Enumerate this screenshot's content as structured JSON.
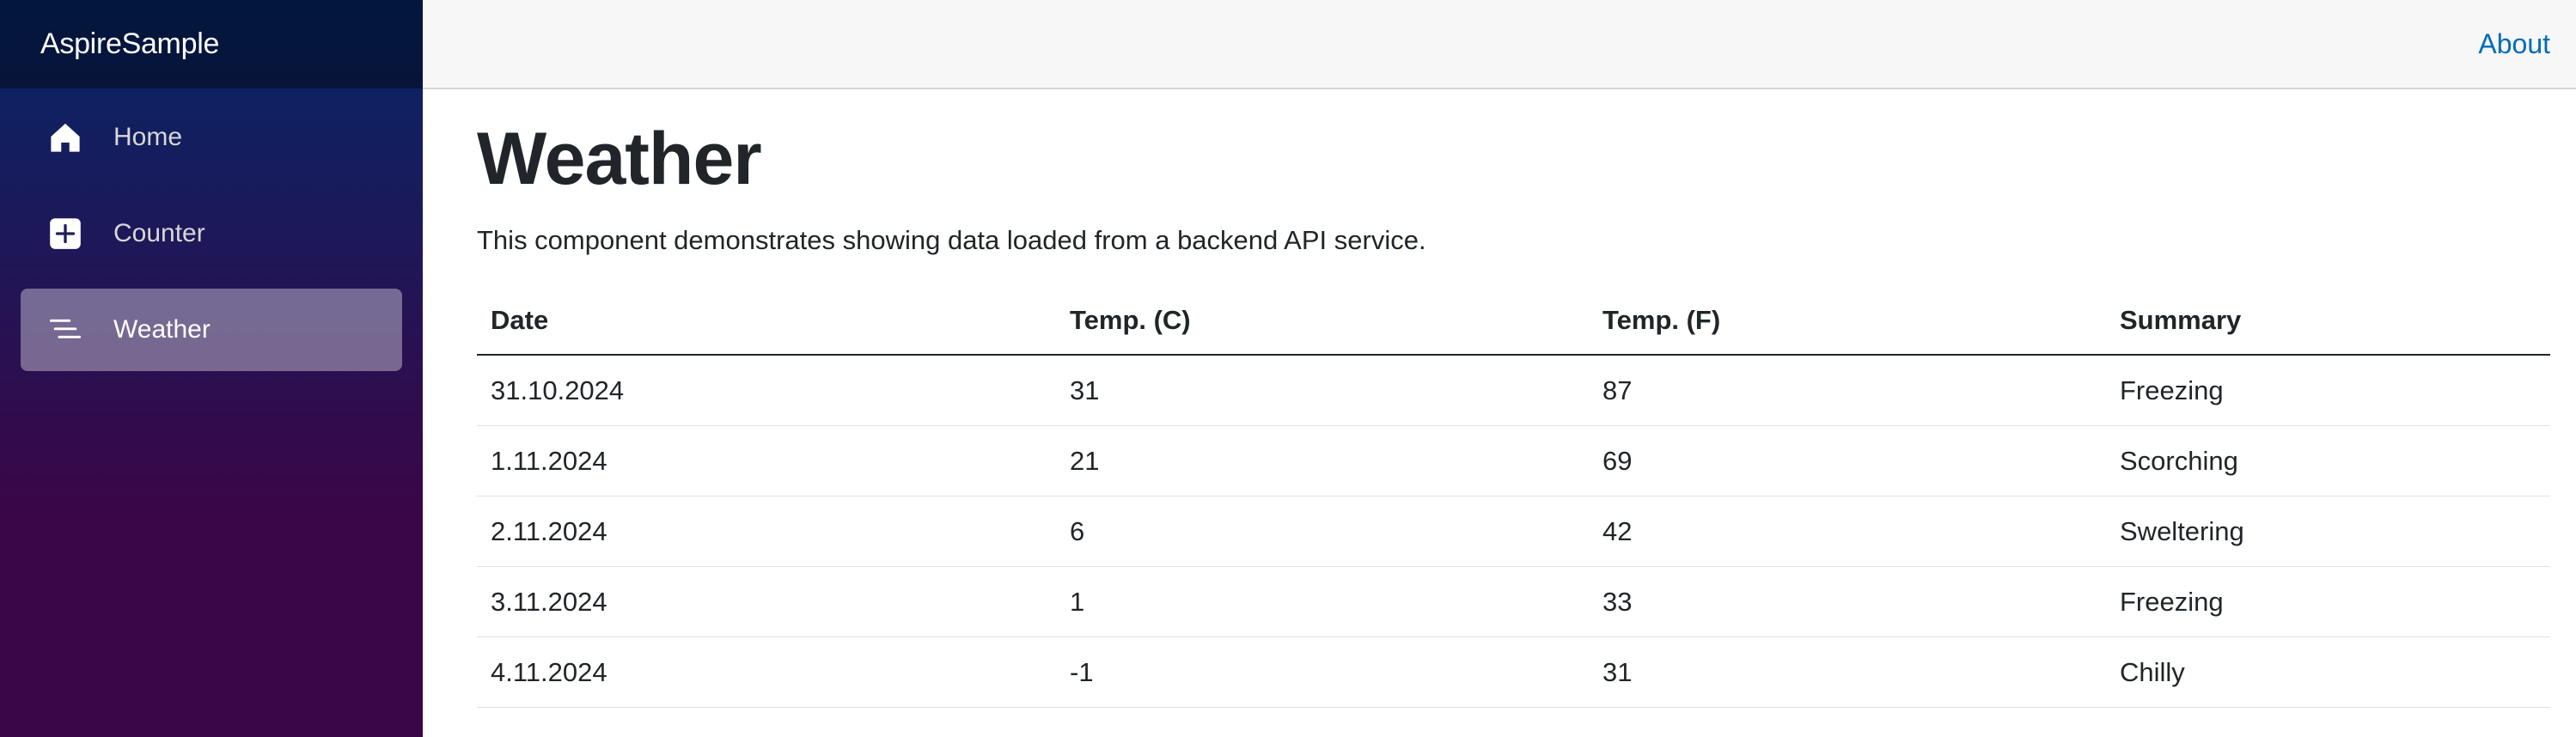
{
  "app": {
    "brand": "AspireSample"
  },
  "sidebar": {
    "items": [
      {
        "label": "Home",
        "icon": "home-icon",
        "active": false
      },
      {
        "label": "Counter",
        "icon": "plus-square-icon",
        "active": false
      },
      {
        "label": "Weather",
        "icon": "list-icon",
        "active": true
      }
    ]
  },
  "top_row": {
    "about_label": "About"
  },
  "page": {
    "title": "Weather",
    "description": "This component demonstrates showing data loaded from a backend API service."
  },
  "table": {
    "headers": [
      "Date",
      "Temp. (C)",
      "Temp. (F)",
      "Summary"
    ],
    "rows": [
      [
        "31.10.2024",
        "31",
        "87",
        "Freezing"
      ],
      [
        "1.11.2024",
        "21",
        "69",
        "Scorching"
      ],
      [
        "2.11.2024",
        "6",
        "42",
        "Sweltering"
      ],
      [
        "3.11.2024",
        "1",
        "33",
        "Freezing"
      ],
      [
        "4.11.2024",
        "-1",
        "31",
        "Chilly"
      ]
    ]
  },
  "colors": {
    "sidebar_gradient_start": "#052767",
    "sidebar_gradient_end": "#3a0647",
    "link": "#006bb7",
    "top_row_bg": "#f7f7f7"
  }
}
